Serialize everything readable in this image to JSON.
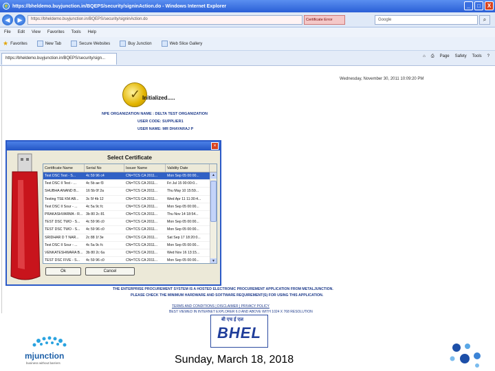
{
  "window": {
    "title": "https://bheldemo.buyjunction.in/BQEPS/security/signinAction.do - Windows Internet Explorer",
    "url": "https://bheldemo.buyjunction.in/BQEPS/security/signinAction.do",
    "cert_error": "Certificate Error",
    "search_placeholder": "Google",
    "minimize": "_",
    "maximize": "□",
    "close": "X"
  },
  "menu": [
    "File",
    "Edit",
    "View",
    "Favorites",
    "Tools",
    "Help"
  ],
  "favorites_bar": {
    "favorites": "Favorites",
    "items": [
      "New Tab",
      "Secure Websites",
      "Buy Junction",
      "Web Slice Gallery"
    ]
  },
  "tab": {
    "label": "https://bheldemo.buyjunction.in/BQEPS/security/sign...",
    "tools": [
      "Page",
      "Safety",
      "Tools"
    ]
  },
  "page": {
    "datetime": "Wednesday, November 30, 2011 10:09:20 PM",
    "status": "Initialized.....",
    "info": [
      "NPE ORGANIZATION NAME : DELTA TEST ORGANIZATION",
      "USER CODE: SUPPLIER1",
      "USER NAME: MR DHAYARAJ P"
    ],
    "notice": [
      "THE ENTERPRISE PROCUREMENT SYSTEM IS A HOSTED ELECTRONIC PROCUREMENT APPLICATION FROM METALJUNCTION.",
      "PLEASE CHECK THE MINIMUM HARDWARE AND SOFTWARE REQUIREMENT(S) FOR USING THIS APPLICATION."
    ],
    "footer_links": [
      "TERMS AND CONDITIONS | DISCLAIMER | PRIVACY POLICY",
      "BEST VIEWED IN INTERNET EXPLORER 6.0 AND ABOVE WITH 1024 X 768 RESOLUTION"
    ]
  },
  "dialog": {
    "title": "Select Certificate",
    "columns": [
      "Certificate Name",
      "Serial No",
      "Issuer Name",
      "Validity Date"
    ],
    "rows": [
      [
        "Test DSC Test - S...",
        "4c 59 96 c4",
        "CN=TCS CA 2011...",
        "Mon Sep 05 00:00..."
      ],
      [
        "Test DSC II Test - ...",
        "4c 5b ae f3",
        "CN=TCS CA 2011...",
        "Fri Jul 15 00:00:0..."
      ],
      [
        "SHUBHA ANAND B...",
        "16 5b 0f 2a",
        "CN=TCS CA 2011...",
        "Thu May 10 15:59..."
      ],
      [
        "Testing TSE KM AB...",
        "3c 5f 4b 12",
        "CN=TCS CA 2011...",
        "Wed Apr 11 11:30:4..."
      ],
      [
        "Test DSC II Sour - ...",
        "4c 5a 9c fc",
        "CN=TCS CA 2011...",
        "Mon Sep 05 00:00..."
      ],
      [
        "PRAKASHVARMA - R...",
        "3b 80 2c 81",
        "CN=TCS CA 2011...",
        "Thu Nov 14 18:54..."
      ],
      [
        "TEST DSC TWO - S...",
        "4c 59 96 c0",
        "CN=TCS CA 2011...",
        "Mon Sep 05 00:00..."
      ],
      [
        "TEST DSC TWO - S...",
        "4c 59 96 c0",
        "CN=TCS CA 2011...",
        "Mon Sep 05 00:00..."
      ],
      [
        "SRIDHAR D T NAR...",
        "2c 88 1f 3e",
        "CN=TCS CA 2011...",
        "Sat Sep 17 18:20:0..."
      ],
      [
        "Test DSC II Sour - ...",
        "4c 5a 9c fc",
        "CN=TCS CA 2011...",
        "Mon Sep 05 00:00..."
      ],
      [
        "VENKATESHWARA B...",
        "3b 80 2c 6a",
        "CN=TCS CA 2011...",
        "Wed Nov 16 13:15..."
      ],
      [
        "TEST DSC FIVE - S...",
        "4c 59 96 c0",
        "CN=TCS CA 2011...",
        "Mon Sep 05 00:00..."
      ]
    ],
    "ok": "Ok",
    "cancel": "Cancel"
  },
  "slide": {
    "mjunction": "mjunction",
    "mjunction_tag": "business without barriers",
    "bhel_top": "बी एच ई एल",
    "bhel": "BHEL",
    "date": "Sunday, March 18, 2018"
  },
  "colors": {
    "titlebar": "#2a5fd6",
    "selection": "#3161c5",
    "info_text": "#1d3a8a",
    "usb_red": "#c8141c"
  }
}
